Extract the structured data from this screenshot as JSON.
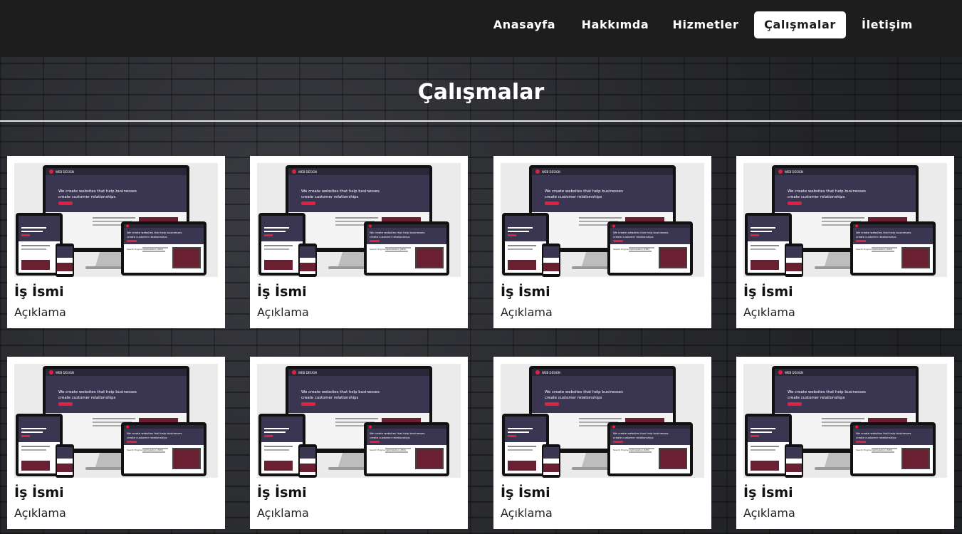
{
  "nav": {
    "items": [
      {
        "label": "Anasayfa",
        "active": false
      },
      {
        "label": "Hakkımda",
        "active": false
      },
      {
        "label": "Hizmetler",
        "active": false
      },
      {
        "label": "Çalışmalar",
        "active": true
      },
      {
        "label": "İletişim",
        "active": false
      }
    ]
  },
  "section": {
    "title": "Çalışmalar"
  },
  "mockup": {
    "brand": "WEB DESIGN",
    "headline": "We create websites that help businesses",
    "subline": "create customer relationships",
    "tablet_headline": "We create websites that help businesses",
    "tablet_subline": "create customer relationships",
    "seo_text": "Search Engine Optimization (SEO)"
  },
  "colors": {
    "nav_bg": "#1d1d1d",
    "accent_red": "#e02040",
    "mockup_dark": "#3a3550",
    "card_bg": "#ffffff"
  },
  "projects": [
    {
      "title": "İş İsmi",
      "description": "Açıklama"
    },
    {
      "title": "İş İsmi",
      "description": "Açıklama"
    },
    {
      "title": "İş İsmi",
      "description": "Açıklama"
    },
    {
      "title": "İş İsmi",
      "description": "Açıklama"
    },
    {
      "title": "İş İsmi",
      "description": "Açıklama"
    },
    {
      "title": "İş İsmi",
      "description": "Açıklama"
    },
    {
      "title": "İş İsmi",
      "description": "Açıklama"
    },
    {
      "title": "İş İsmi",
      "description": "Açıklama"
    }
  ]
}
